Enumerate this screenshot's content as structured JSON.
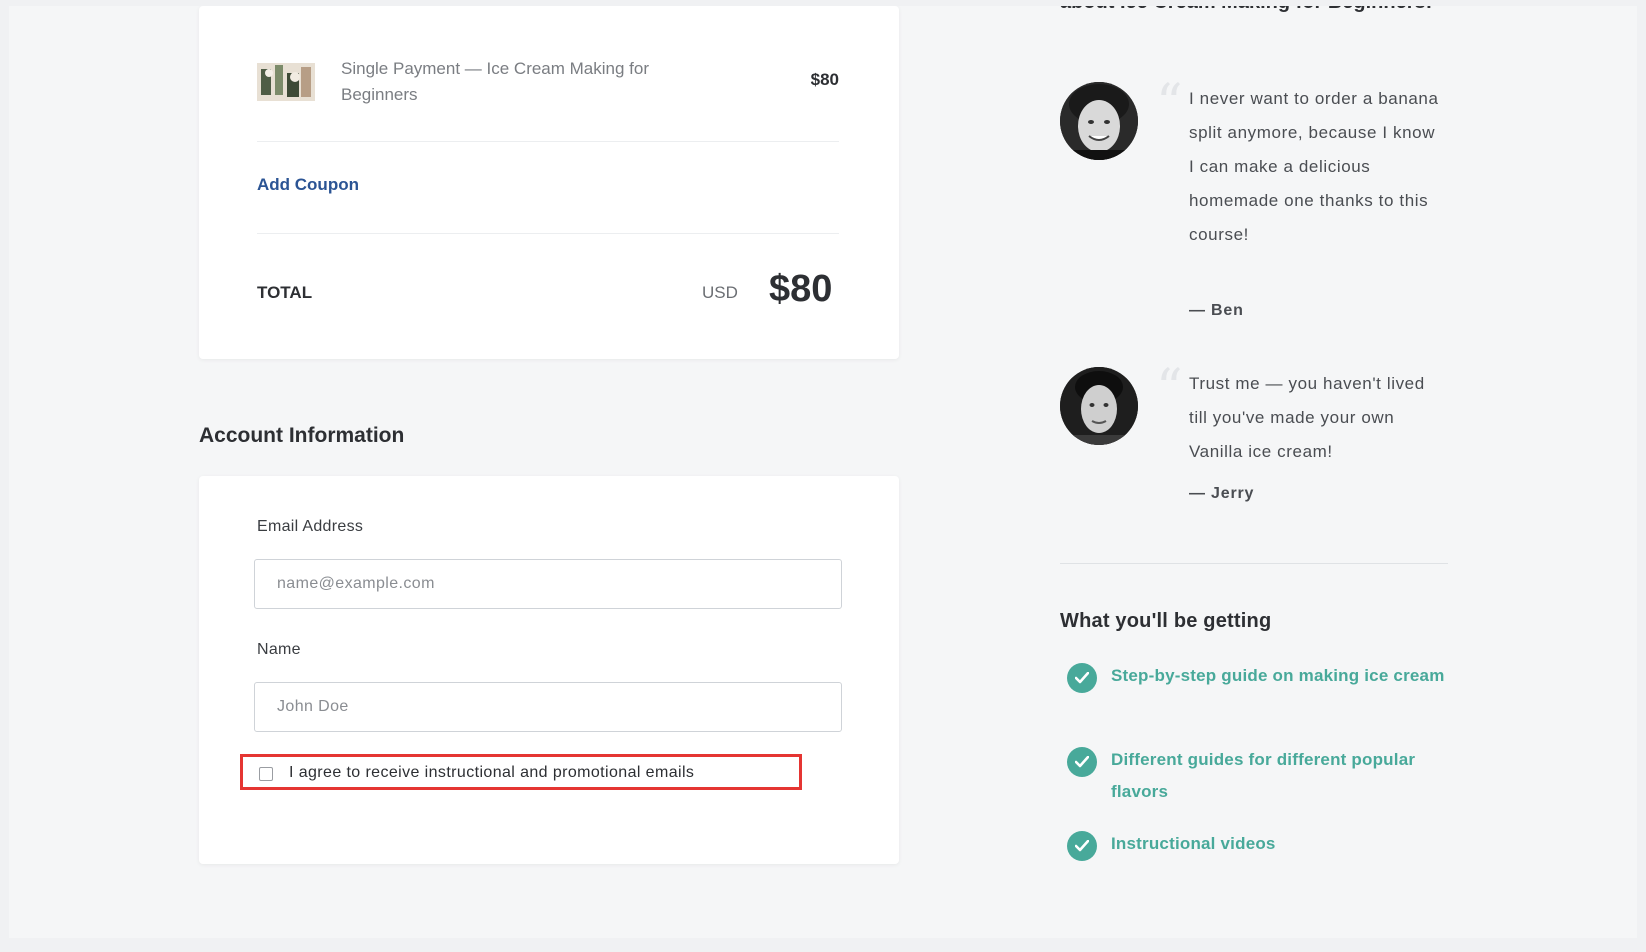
{
  "order": {
    "product_name": "Single Payment — Ice Cream Making for Beginners",
    "product_price": "$80",
    "coupon_label": "Add Coupon",
    "total_label": "TOTAL",
    "total_currency": "USD",
    "total_amount": "$80"
  },
  "account": {
    "title": "Account Information",
    "email_label": "Email Address",
    "email_placeholder": "name@example.com",
    "name_label": "Name",
    "name_placeholder": "John Doe",
    "consent_label": "I agree to receive instructional and promotional emails",
    "consent_checked": false
  },
  "testimonials": {
    "heading": "about Ice Cream Making for Beginners!",
    "items": [
      {
        "quote": "I never want to order a banana split anymore, because I know I can make a delicious homemade one thanks to this course!",
        "author": "— Ben"
      },
      {
        "quote": "Trust me — you haven't lived till you've made your own Vanilla ice cream!",
        "author": "— Jerry"
      }
    ]
  },
  "benefits": {
    "title": "What you'll be getting",
    "items": [
      "Step-by-step guide on making ice cream",
      "Different guides for different popular flavors",
      "Instructional videos"
    ]
  },
  "colors": {
    "accent_teal": "#48a99a",
    "link_blue": "#2b5494",
    "highlight_red": "#e53532"
  },
  "icons": {
    "benefit": "check-circle-icon",
    "quote": "quote-mark-icon"
  }
}
